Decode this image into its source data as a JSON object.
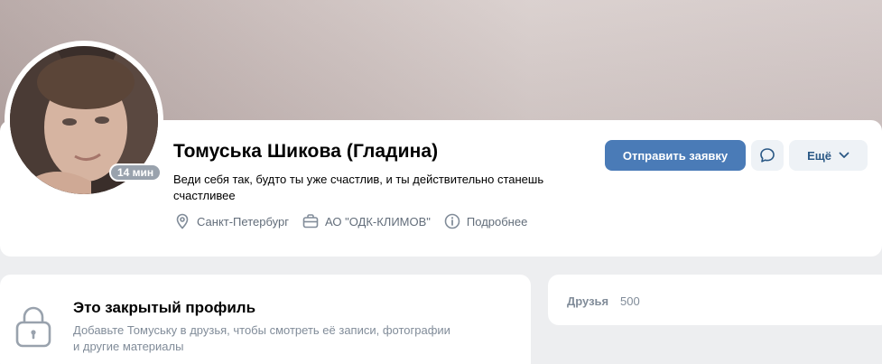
{
  "profile": {
    "name": "Томуська Шикова (Гладина)",
    "status": "Веди себя так, будто ты уже счастлив, и ты действительно станешь счастливее",
    "online": "14 мин",
    "city": "Санкт-Петербург",
    "work": "АО \"ОДК-КЛИМОВ\"",
    "details": "Подробнее"
  },
  "actions": {
    "send_request": "Отправить заявку",
    "more": "Ещё",
    "message_icon": "message-bubble-icon",
    "more_icon": "chevron-down-icon"
  },
  "closed": {
    "title": "Это закрытый профиль",
    "description": "Добавьте Томуську в друзья, чтобы смотреть её записи, фотографии и другие материалы",
    "icon": "lock-icon"
  },
  "friends": {
    "label": "Друзья",
    "count": "500"
  },
  "colors": {
    "primary": "#4a7bb7",
    "link": "#2a5885",
    "secondary_text": "#818c99",
    "page_bg": "#edeef0"
  }
}
